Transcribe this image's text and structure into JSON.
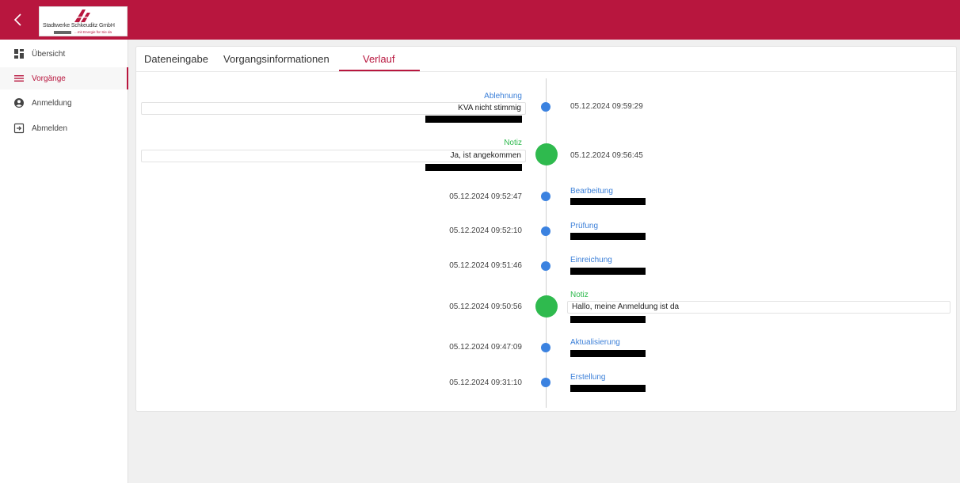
{
  "header": {
    "logo_name": "Stadtwerke Schkeuditz GmbH",
    "logo_tagline": "...mit Energie für Sie da",
    "brand_color": "#b8163e"
  },
  "sidebar": {
    "items": [
      {
        "label": "Übersicht",
        "icon": "dashboard-icon"
      },
      {
        "label": "Vorgänge",
        "icon": "menu-icon",
        "active": true
      },
      {
        "label": "Anmeldung",
        "icon": "account-circle-icon"
      },
      {
        "label": "Abmelden",
        "icon": "logout-icon"
      }
    ]
  },
  "tabs": [
    {
      "label": "Dateneingabe"
    },
    {
      "label": "Vorgangsinformationen"
    },
    {
      "label": "Verlauf",
      "active": true
    }
  ],
  "timeline": [
    {
      "side": "left",
      "type": "Ablehnung",
      "color": "blue",
      "message": "KVA nicht stimmig",
      "timestamp": "05.12.2024 09:59:29"
    },
    {
      "side": "left",
      "type": "Notiz",
      "color": "green",
      "message": "Ja, ist angekommen",
      "timestamp": "05.12.2024 09:56:45"
    },
    {
      "side": "right",
      "type": "Bearbeitung",
      "color": "blue",
      "timestamp": "05.12.2024 09:52:47"
    },
    {
      "side": "right",
      "type": "Prüfung",
      "color": "blue",
      "timestamp": "05.12.2024 09:52:10"
    },
    {
      "side": "right",
      "type": "Einreichung",
      "color": "blue",
      "timestamp": "05.12.2024 09:51:46"
    },
    {
      "side": "right",
      "type": "Notiz",
      "color": "green",
      "message": "Hallo, meine Anmeldung ist da",
      "timestamp": "05.12.2024 09:50:56"
    },
    {
      "side": "right",
      "type": "Aktualisierung",
      "color": "blue",
      "timestamp": "05.12.2024 09:47:09"
    },
    {
      "side": "right",
      "type": "Erstellung",
      "color": "blue",
      "timestamp": "05.12.2024 09:31:10"
    }
  ]
}
